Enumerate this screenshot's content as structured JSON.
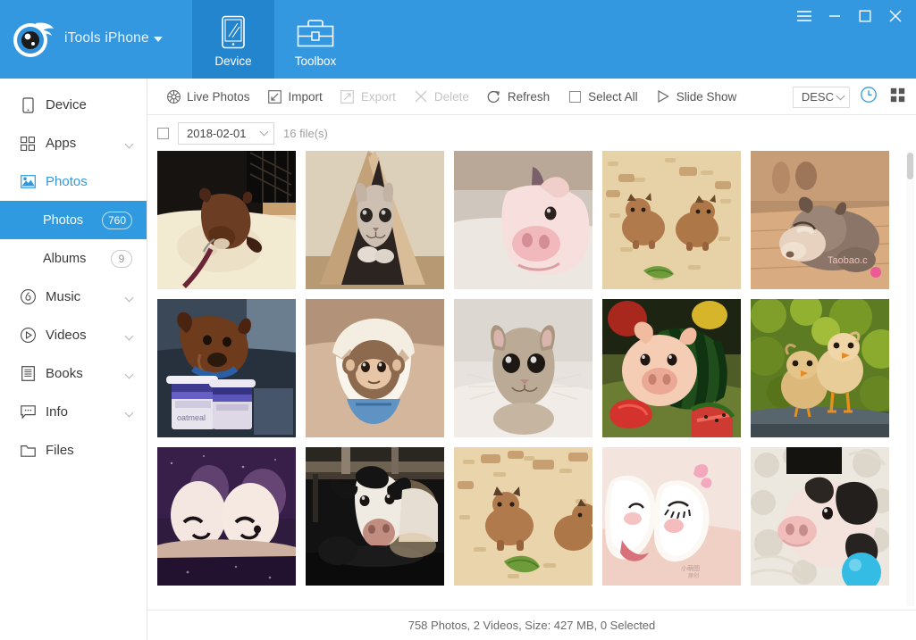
{
  "window": {
    "brand": "iTools iPhone",
    "controls": [
      {
        "name": "menu-button",
        "glyph": "menu"
      },
      {
        "name": "minimize-button",
        "glyph": "minimize"
      },
      {
        "name": "maximize-button",
        "glyph": "maximize"
      },
      {
        "name": "close-button",
        "glyph": "close"
      }
    ],
    "accent": "#3398e0",
    "accent_active": "#2285cd"
  },
  "tabs": [
    {
      "label": "Device",
      "icon": "tablet-icon",
      "active": true
    },
    {
      "label": "Toolbox",
      "icon": "toolbox-icon",
      "active": false
    }
  ],
  "sidebar": {
    "items": [
      {
        "label": "Device",
        "icon": "device-icon",
        "expandable": false,
        "current": false
      },
      {
        "label": "Apps",
        "icon": "apps-icon",
        "expandable": true,
        "current": false
      },
      {
        "label": "Photos",
        "icon": "photos-icon",
        "expandable": false,
        "current": true
      },
      {
        "label": "Music",
        "icon": "music-icon",
        "expandable": true,
        "current": false
      },
      {
        "label": "Videos",
        "icon": "videos-icon",
        "expandable": true,
        "current": false
      },
      {
        "label": "Books",
        "icon": "books-icon",
        "expandable": true,
        "current": false
      },
      {
        "label": "Info",
        "icon": "info-icon",
        "expandable": true,
        "current": false
      },
      {
        "label": "Files",
        "icon": "files-icon",
        "expandable": false,
        "current": false
      }
    ],
    "sub_items": [
      {
        "label": "Photos",
        "badge": "760",
        "selected": true
      },
      {
        "label": "Albums",
        "badge": "9",
        "selected": false
      }
    ]
  },
  "toolbar": {
    "buttons": [
      {
        "label": "Live Photos",
        "icon": "live-photos-icon",
        "disabled": false
      },
      {
        "label": "Import",
        "icon": "import-icon",
        "disabled": false
      },
      {
        "label": "Export",
        "icon": "export-icon",
        "disabled": true
      },
      {
        "label": "Delete",
        "icon": "delete-icon",
        "disabled": true
      },
      {
        "label": "Refresh",
        "icon": "refresh-icon",
        "disabled": false
      },
      {
        "label": "Select All",
        "icon": "checkbox-icon",
        "disabled": false
      },
      {
        "label": "Slide Show",
        "icon": "play-icon",
        "disabled": false
      }
    ],
    "sort_label": "DESC",
    "view_time_icon": "clock-icon",
    "view_grid_icon": "grid-icon",
    "view_active_color": "#2f9ae0"
  },
  "date_group": {
    "date": "2018-02-01",
    "file_count": "16 file(s)"
  },
  "photos": [
    {
      "alt": "puppy-on-leash-thumbnail"
    },
    {
      "alt": "kitten-in-box-thumbnail"
    },
    {
      "alt": "piglet-closeup-thumbnail"
    },
    {
      "alt": "toy-cows-on-sawdust-thumbnail"
    },
    {
      "alt": "sleeping-husky-puppy-thumbnail"
    },
    {
      "alt": "dachshund-in-car-thumbnail"
    },
    {
      "alt": "monkey-in-eggshell-thumbnail"
    },
    {
      "alt": "grey-cat-on-bed-thumbnail"
    },
    {
      "alt": "toy-pig-with-watermelon-thumbnail"
    },
    {
      "alt": "two-chicks-thumbnail"
    },
    {
      "alt": "smiling-eggs-thumbnail"
    },
    {
      "alt": "cow-in-barn-thumbnail"
    },
    {
      "alt": "toy-cows-with-leaf-thumbnail"
    },
    {
      "alt": "dumpling-figurines-thumbnail"
    },
    {
      "alt": "spotted-piglet-thumbnail"
    }
  ],
  "status": {
    "text": "758 Photos, 2 Videos, Size: 427 MB, 0 Selected"
  }
}
